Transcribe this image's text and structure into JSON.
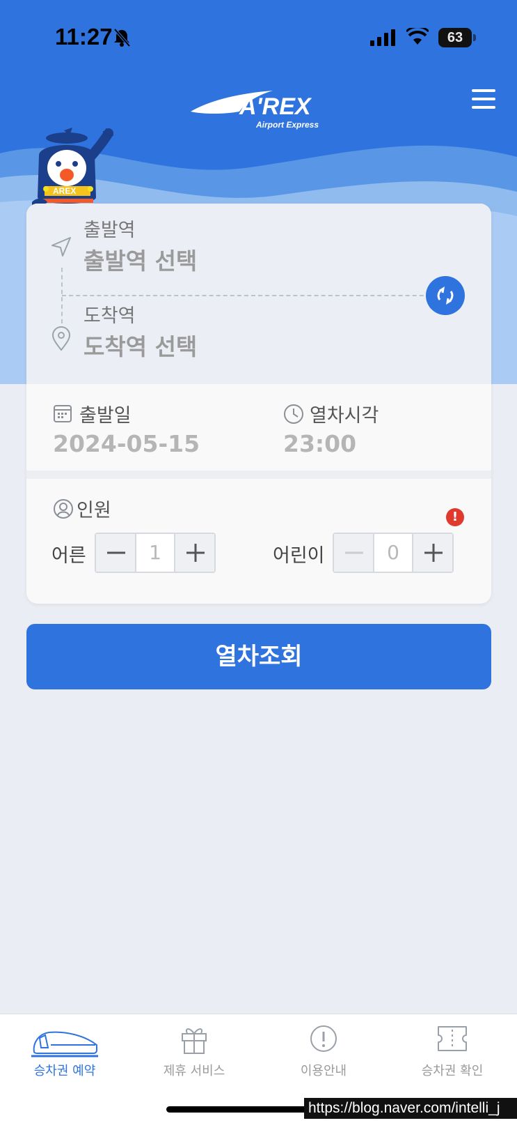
{
  "status_bar": {
    "time": "11:27",
    "battery": "63"
  },
  "header": {
    "logo_text": "A'REX",
    "logo_subtitle": "Airport Express"
  },
  "mascot": {
    "badge_text": "AREX"
  },
  "departure": {
    "label": "출발역",
    "value": "출발역 선택"
  },
  "arrival": {
    "label": "도착역",
    "value": "도착역 선택"
  },
  "date": {
    "label": "출발일",
    "value": "2024-05-15"
  },
  "time": {
    "label": "열차시각",
    "value": "23:00"
  },
  "passengers": {
    "label": "인원",
    "adult": {
      "label": "어른",
      "count": "1"
    },
    "child": {
      "label": "어린이",
      "count": "0"
    }
  },
  "search_button": {
    "label": "열차조회"
  },
  "tabs": [
    {
      "label": "승차권 예약",
      "icon": "train-icon",
      "active": true
    },
    {
      "label": "제휴 서비스",
      "icon": "gift-icon",
      "active": false
    },
    {
      "label": "이용안내",
      "icon": "info-icon",
      "active": false
    },
    {
      "label": "승차권 확인",
      "icon": "ticket-icon",
      "active": false
    }
  ],
  "watermark": "https://blog.naver.com/intelli_j",
  "colors": {
    "primary": "#2f74de",
    "alert": "#e03a2f",
    "background": "#eaedf3"
  }
}
